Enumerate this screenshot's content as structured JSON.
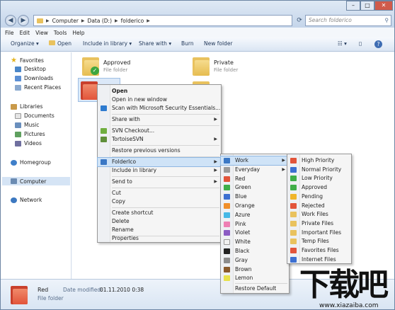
{
  "address": {
    "crumbs": [
      "Computer",
      "Data (D:)",
      "folderico"
    ],
    "search_placeholder": "Search folderico"
  },
  "window_controls": {
    "minimize": "–",
    "maximize": "□",
    "close": "✕"
  },
  "menubar": [
    "File",
    "Edit",
    "View",
    "Tools",
    "Help"
  ],
  "toolbar": {
    "organize": "Organize ▾",
    "open": "Open",
    "include": "Include in library ▾",
    "share": "Share with ▾",
    "burn": "Burn",
    "newfolder": "New folder"
  },
  "navpane": {
    "favorites": "Favorites",
    "desktop": "Desktop",
    "downloads": "Downloads",
    "recent": "Recent Places",
    "libraries": "Libraries",
    "documents": "Documents",
    "music": "Music",
    "pictures": "Pictures",
    "videos": "Videos",
    "homegroup": "Homegroup",
    "computer": "Computer",
    "network": "Network"
  },
  "files": [
    {
      "name": "Approved",
      "type": "File folder"
    },
    {
      "name": "Private",
      "type": "File folder"
    }
  ],
  "context_menu": {
    "open": "Open",
    "open_new": "Open in new window",
    "scan": "Scan with Microsoft Security Essentials...",
    "share": "Share with",
    "svn_checkout": "SVN Checkout...",
    "tortoise": "TortoiseSVN",
    "restore_prev": "Restore previous versions",
    "folderico": "FolderIco",
    "include": "Include in library",
    "send_to": "Send to",
    "cut": "Cut",
    "copy": "Copy",
    "create_shortcut": "Create shortcut",
    "delete": "Delete",
    "rename": "Rename",
    "properties": "Properties"
  },
  "folderico_menu": {
    "items": [
      "Work",
      "Everyday",
      "Red",
      "Green",
      "Blue",
      "Orange",
      "Azure",
      "Pink",
      "Violet",
      "White",
      "Black",
      "Gray",
      "Brown",
      "Lemon"
    ],
    "restore": "Restore Default"
  },
  "work_menu": {
    "items": [
      "High Priority",
      "Normal Priority",
      "Low Priority",
      "Approved",
      "Pending",
      "Rejected",
      "Work Files",
      "Private Files",
      "Important Files",
      "Temp Files",
      "Favorites Files",
      "Internet Files"
    ]
  },
  "details": {
    "name": "Red",
    "modified_label": "Date modified:",
    "modified": "01.11.2010 0:38",
    "type": "File folder"
  },
  "watermark": {
    "logo": "下载吧",
    "url": "www.xiazaiba.com"
  },
  "colors": {
    "accent": "#cfe3f7",
    "folder_yellow": "#e9c25e",
    "folder_red": "#e2543a",
    "titlebar": "#c4d5ea"
  }
}
